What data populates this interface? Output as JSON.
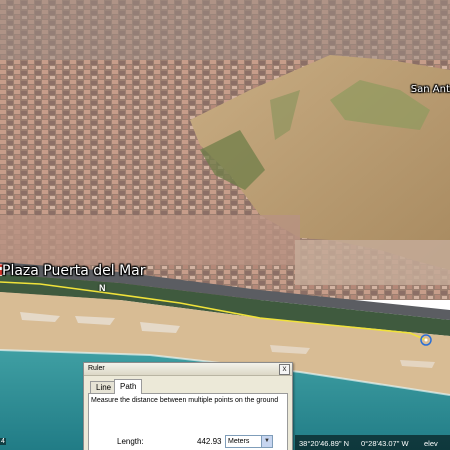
{
  "map": {
    "place_labels": {
      "plaza": "Plaza Puerta del Mar",
      "san_anton": "San Antó"
    },
    "compass_label": "N"
  },
  "ruler": {
    "title": "Ruler",
    "close_label": "x",
    "tabs": {
      "line": "Line",
      "path": "Path"
    },
    "active_tab": "Path",
    "description": "Measure the distance between multiple points on the ground",
    "length_label": "Length:",
    "length_value": "442.93",
    "units": "Meters"
  },
  "status": {
    "lat": "38°20'46.89\" N",
    "lon": "0°28'43.07\" W",
    "elev": "elev",
    "left_indicator": "4"
  },
  "colors": {
    "sea": "#2f8f95",
    "beach": "#d8bc94",
    "path": "#f0e23a"
  }
}
